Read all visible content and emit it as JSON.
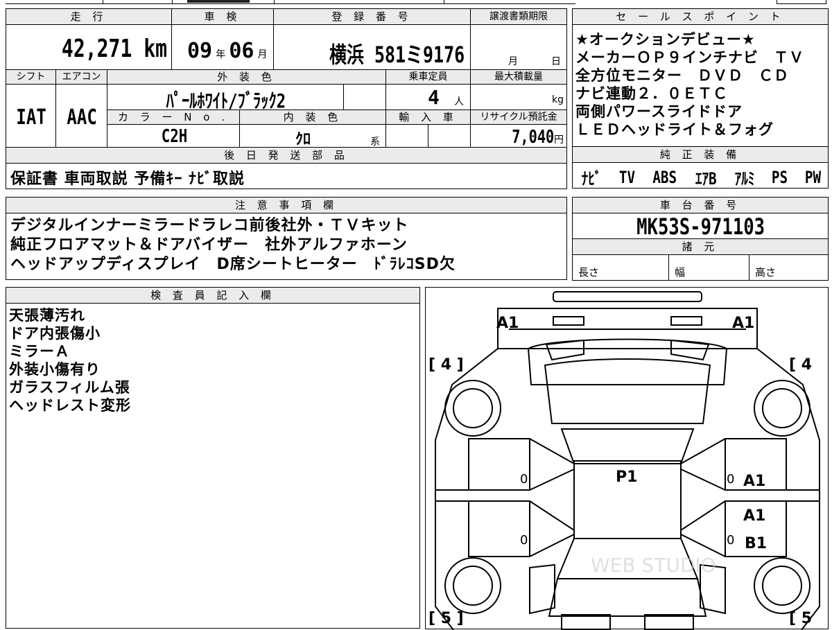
{
  "top_table": {
    "headers": {
      "mileage": "走 行",
      "inspection": "車 検",
      "registration": "登 録 番 号",
      "transfer_deadline": "譲渡書類期限",
      "shift": "シフト",
      "aircon": "エアコン",
      "exterior_color": "外 装 色",
      "capacity": "乗車定員",
      "max_load": "最大積載量",
      "color_no": "カ ラ ー N o .",
      "interior_color": "内 装 色",
      "import": "輸 入 車",
      "recycle_fee": "リサイクル預託金"
    },
    "values": {
      "mileage": "42,271",
      "mileage_unit": "km",
      "inspection_year": "09",
      "inspection_year_unit": "年",
      "inspection_month": "06",
      "inspection_month_unit": "月",
      "registration": "横浜 581ミ9176",
      "transfer_month_unit": "月",
      "transfer_day_unit": "日",
      "shift": "IAT",
      "aircon": "AAC",
      "exterior_color": "ﾊﾟｰﾙﾎﾜｲﾄ/ﾌﾞﾗｯｸ2",
      "capacity": "4",
      "capacity_unit": "人",
      "max_load_unit": "kg",
      "color_no": "C2H",
      "interior_color": "ｸﾛ",
      "interior_color_suffix": "系",
      "recycle_fee": "7,040",
      "recycle_fee_unit": "円"
    }
  },
  "later_shipping": {
    "header": "後 日 発 送 部 品",
    "value": "保証書 車両取説 予備ｷｰ ﾅﾋﾞ取説"
  },
  "sales_points": {
    "header": "セ ー ル ス ポ イ ン ト",
    "lines": [
      "★オークションデビュー★",
      "メーカーＯＰ９インチナビ　ＴＶ",
      "全方位モニター　ＤＶＤ　ＣＤ",
      "ナビ連動２．０ＥＴＣ",
      "両側パワースライドドア",
      "ＬＥＤヘッドライト＆フォグ"
    ]
  },
  "genuine_equipment": {
    "header": "純 正 装 備",
    "items": [
      "ﾅﾋﾞ",
      "TV",
      "ABS",
      "ｴｱB",
      "ｱﾙﾐ",
      "PS",
      "PW"
    ]
  },
  "notes": {
    "header": "注 意 事 項 欄",
    "lines": [
      "デジタルインナーミラードラレコ前後社外・ＴＶキット",
      "純正フロアマット＆ドアバイザー　社外アルファホーン",
      "ヘッドアップディスプレイ　D席シートヒーター　ﾄﾞﾗﾚｺSD欠"
    ]
  },
  "chassis": {
    "header": "車 台 番 号",
    "value": "MK53S-971103"
  },
  "specs": {
    "header": "諸 元",
    "length": "長さ",
    "width": "幅",
    "height": "高さ"
  },
  "inspector": {
    "header": "検 査 員 記 入 欄",
    "lines": [
      "天張薄汚れ",
      "ドア内張傷小",
      "ミラーＡ",
      "外装小傷有り",
      "ガラスフィルム張",
      "ヘッドレスト変形"
    ]
  },
  "diagram": {
    "marks": {
      "a1_front_left": "A1",
      "a1_front_right": "A1",
      "tire_fl": "[ 4 ]",
      "tire_fr": "[ 4",
      "tire_rl": "[ 5 ]",
      "tire_rr": "[ 5",
      "p1": "P1",
      "zero_l1": "0",
      "zero_l2": "0",
      "zero_r1": "0",
      "zero_r2": "0",
      "a1_right_door1": "A1",
      "a1_right_door2": "A1",
      "b1_right_door2": "B1"
    },
    "watermark": "WEB STUDIO"
  }
}
